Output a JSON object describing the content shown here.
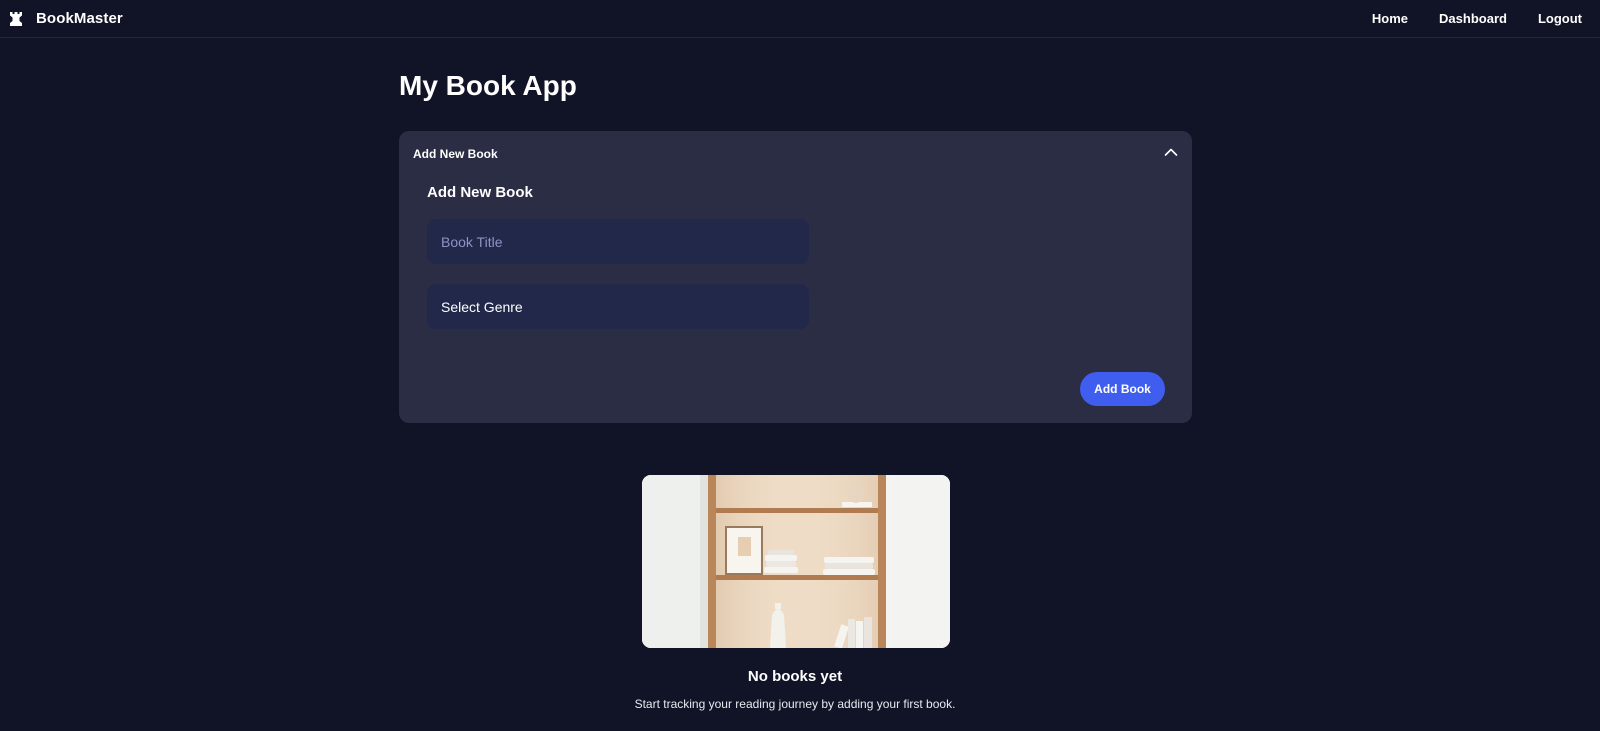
{
  "navbar": {
    "brand_name": "BookMaster",
    "brand_icon": "castle-icon",
    "links": [
      {
        "label": "Home"
      },
      {
        "label": "Dashboard"
      },
      {
        "label": "Logout"
      }
    ]
  },
  "page": {
    "title": "My Book App"
  },
  "add_panel": {
    "header_label": "Add New Book",
    "toggle_icon": "chevron-up-icon",
    "form_title": "Add New Book",
    "title_input": {
      "value": "",
      "placeholder": "Book Title"
    },
    "genre_select": {
      "selected": "Select Genre"
    },
    "submit_label": "Add Book"
  },
  "empty_state": {
    "image": "bookshelf-illustration",
    "title": "No books yet",
    "message": "Start tracking your reading journey by adding your first book."
  },
  "colors": {
    "background": "#111426",
    "panel": "#2a2d44",
    "input": "#21284a",
    "accent": "#3f5ef0"
  }
}
